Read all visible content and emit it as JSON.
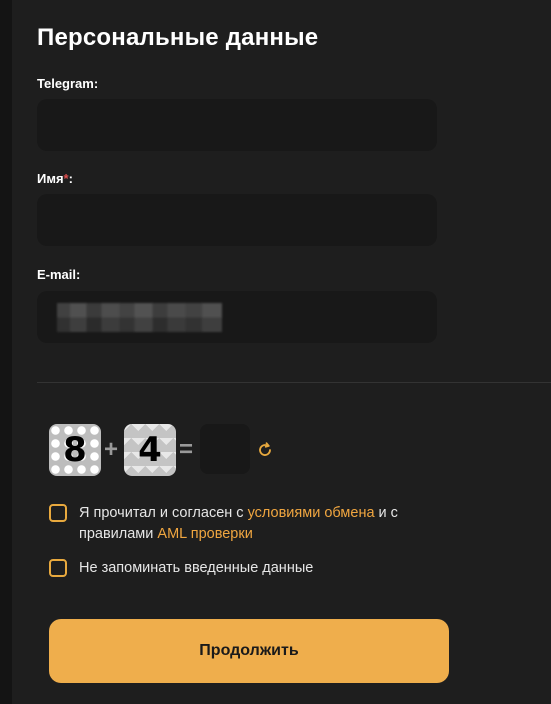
{
  "form": {
    "title": "Персональные данные",
    "telegram": {
      "label": "Telegram:",
      "value": "",
      "placeholder": ""
    },
    "name": {
      "label": "Имя",
      "required_mark": "*",
      "colon": ":",
      "value": "",
      "placeholder": ""
    },
    "email": {
      "label": "E-mail:",
      "value": "",
      "placeholder": ""
    }
  },
  "captcha": {
    "first_number": "8",
    "operator": "+",
    "second_number": "4",
    "equals": "=",
    "answer": "",
    "refresh_icon": "refresh-icon"
  },
  "agreements": {
    "terms": {
      "prefix": "Я прочитал и согласен с ",
      "link1": "условиями обмена",
      "middle": " и с правилами ",
      "link2": "AML проверки",
      "checked": false
    },
    "remember": {
      "text": "Не запоминать введенные данные",
      "checked": false
    }
  },
  "submit": {
    "label": "Продолжить"
  },
  "colors": {
    "accent": "#efae4c",
    "link": "#f0a640",
    "background": "#1e1e1e",
    "input_bg": "#181818",
    "required": "#e05050"
  }
}
